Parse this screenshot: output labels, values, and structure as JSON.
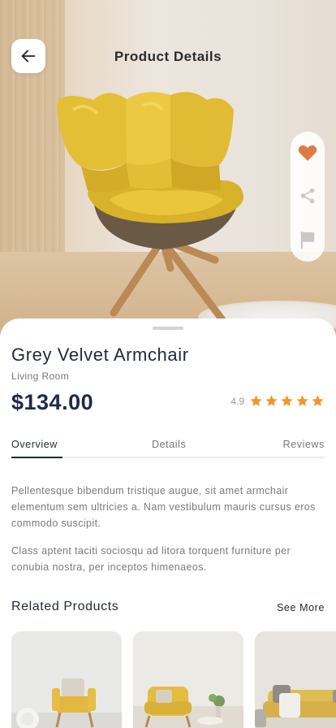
{
  "header": {
    "title": "Product Details",
    "back_icon": "arrow-left-icon"
  },
  "actions": {
    "favorite_icon": "heart-icon",
    "share_icon": "share-icon",
    "report_icon": "flag-icon",
    "favorite_color": "#e07a45"
  },
  "product": {
    "name": "Grey Velvet Armchair",
    "category": "Living Room",
    "price": "$134.00",
    "rating": "4.9",
    "stars": 5,
    "star_color": "#f0962a"
  },
  "tabs": [
    {
      "label": "Overview",
      "active": true
    },
    {
      "label": "Details",
      "active": false
    },
    {
      "label": "Reviews",
      "active": false
    }
  ],
  "overview": {
    "paragraphs": [
      "Pellentesque bibendum tristique augue, sit amet armchair elementum sem ultricies a. Nam vestibulum mauris cursus eros commodo suscipit.",
      "Class aptent taciti sociosqu ad litora torquent furniture per conubia nostra, per inceptos himenaeos."
    ]
  },
  "related": {
    "title": "Related Products",
    "see_more": "See More"
  },
  "colors": {
    "primary_text": "#1f2a3a",
    "muted_text": "#7a7a7a",
    "chair_yellow": "#e6c23a"
  }
}
